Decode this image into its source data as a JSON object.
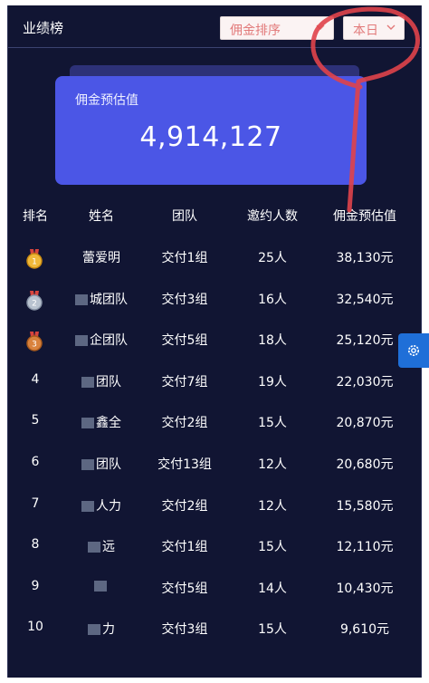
{
  "header": {
    "title": "业绩榜",
    "sort_select": "佣金排序",
    "period_select": "本日"
  },
  "summary": {
    "label": "佣金预估值",
    "value": "4,914,127"
  },
  "table": {
    "columns": [
      "排名",
      "姓名",
      "团队",
      "邀约人数",
      "佣金预估值"
    ],
    "rows": [
      {
        "rank": "",
        "medal": "gold-medal-icon",
        "name": "蕾爱明",
        "team": "交付1组",
        "invites": "25人",
        "commission": "38,130元"
      },
      {
        "rank": "",
        "medal": "silver-medal-icon",
        "name": "城团队",
        "team": "交付3组",
        "invites": "16人",
        "commission": "32,540元"
      },
      {
        "rank": "",
        "medal": "bronze-medal-icon",
        "name": "企团队",
        "team": "交付5组",
        "invites": "18人",
        "commission": "25,120元"
      },
      {
        "rank": "4",
        "name": "团队",
        "team": "交付7组",
        "invites": "19人",
        "commission": "22,030元"
      },
      {
        "rank": "5",
        "name": "鑫全",
        "team": "交付2组",
        "invites": "15人",
        "commission": "20,870元"
      },
      {
        "rank": "6",
        "name": "团队",
        "team": "交付13组",
        "invites": "12人",
        "commission": "20,680元"
      },
      {
        "rank": "7",
        "name": "人力",
        "team": "交付2组",
        "invites": "12人",
        "commission": "15,580元"
      },
      {
        "rank": "8",
        "name": "远",
        "team": "交付1组",
        "invites": "15人",
        "commission": "12,110元"
      },
      {
        "rank": "9",
        "name": "",
        "team": "交付5组",
        "invites": "14人",
        "commission": "10,430元"
      },
      {
        "rank": "10",
        "name": "力",
        "team": "交付3组",
        "invites": "15人",
        "commission": "9,610元"
      }
    ]
  },
  "colors": {
    "panel_bg": "#111533",
    "card_bg": "#4b56e6",
    "accent_select": "#e27a7a",
    "annotation_red": "#e0434a",
    "settings_blue": "#1f6fd8"
  }
}
